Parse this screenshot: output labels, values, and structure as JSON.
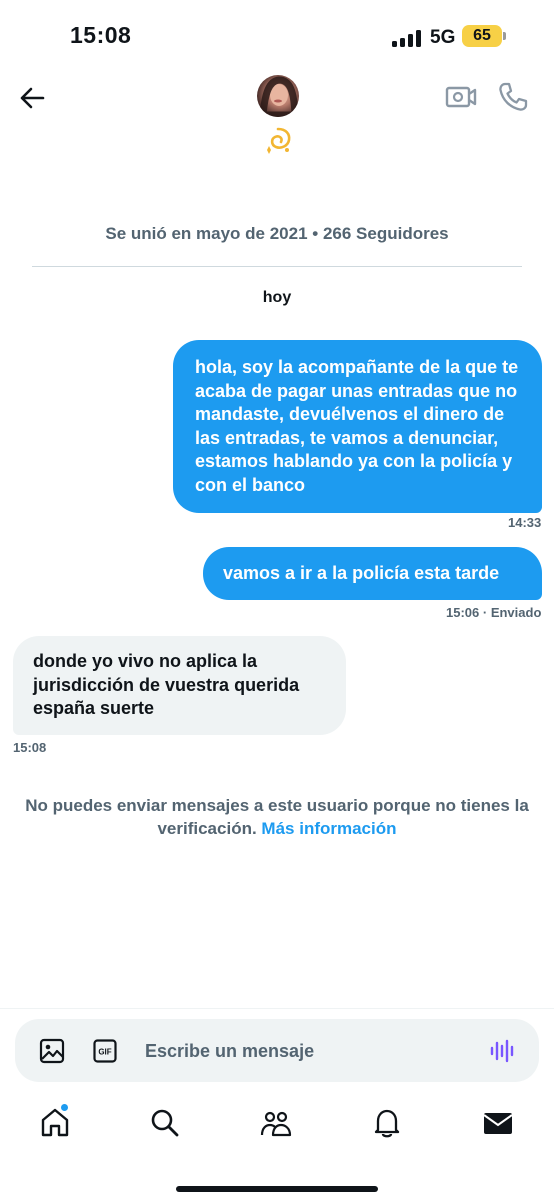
{
  "status_bar": {
    "time": "15:08",
    "network": "5G",
    "battery": "65"
  },
  "header": {
    "back_icon": "arrow-left-icon",
    "avatar_icon": "profile-avatar",
    "emoji_icon": "dizzy-emoji-icon",
    "video_icon": "video-camera-icon",
    "call_icon": "phone-icon"
  },
  "profile_meta": "Se unió en mayo de 2021 • 266 Seguidores",
  "day_label": "hoy",
  "messages": [
    {
      "direction": "sent",
      "text": "hola, soy la acompañante de la que te acaba de pagar unas entradas que no mandaste, devuélvenos el dinero de las entradas, te vamos a denunciar, estamos hablando ya con la policía y con el banco",
      "time": "14:33",
      "status": ""
    },
    {
      "direction": "sent",
      "text": "vamos a ir a la policía esta tarde",
      "time": "15:06",
      "status": "· Enviado"
    },
    {
      "direction": "received",
      "text": "donde yo vivo no aplica la jurisdicción de vuestra querida españa suerte",
      "time": "15:08",
      "status": ""
    }
  ],
  "notice": {
    "text": "No puedes enviar mensajes a este usuario porque no tienes la verificación.",
    "link": "Más información"
  },
  "composer": {
    "placeholder": "Escribe un mensaje",
    "image_icon": "image-icon",
    "gif_label": "GIF",
    "voice_icon": "voice-wave-icon"
  },
  "tabs": [
    {
      "name": "home",
      "icon": "home-icon",
      "has_badge": true
    },
    {
      "name": "search",
      "icon": "search-icon",
      "has_badge": false
    },
    {
      "name": "communities",
      "icon": "people-icon",
      "has_badge": false
    },
    {
      "name": "notifications",
      "icon": "bell-icon",
      "has_badge": false
    },
    {
      "name": "messages",
      "icon": "envelope-icon",
      "has_badge": false
    }
  ],
  "colors": {
    "accent": "#1d9bf0",
    "sent_bubble": "#1d9bf0",
    "received_bubble": "#eff3f4",
    "secondary_text": "#536471",
    "battery": "#f7d046",
    "voice_icon": "#7856ff"
  }
}
